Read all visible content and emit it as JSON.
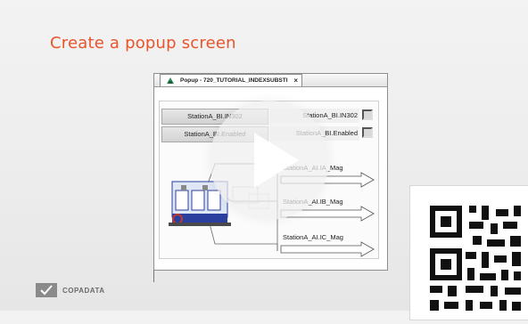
{
  "slide": {
    "title": "Create a popup screen"
  },
  "popup": {
    "tab_title": "Popup - 720_TUTORIAL_INDEXSUBSTI",
    "tab_close": "×",
    "rows": [
      {
        "label": "StationA_BI.IN302",
        "value": "StationA_BI.IN302"
      },
      {
        "label": "StationA_BI.Enabled",
        "value": "StationA_BI.Enabled"
      }
    ],
    "arrows": [
      {
        "label": "StationA_AI.IA_Mag"
      },
      {
        "label": "StationA_AI.IB_Mag"
      },
      {
        "label": "StationA_AI.IC_Mag"
      }
    ]
  },
  "video": {
    "play_icon": "play-icon"
  },
  "footer": {
    "logo_text": "COPADATA"
  },
  "colors": {
    "title": "#e8542b",
    "accent_blue": "#2a3f9e",
    "accent_red": "#c0392b"
  }
}
